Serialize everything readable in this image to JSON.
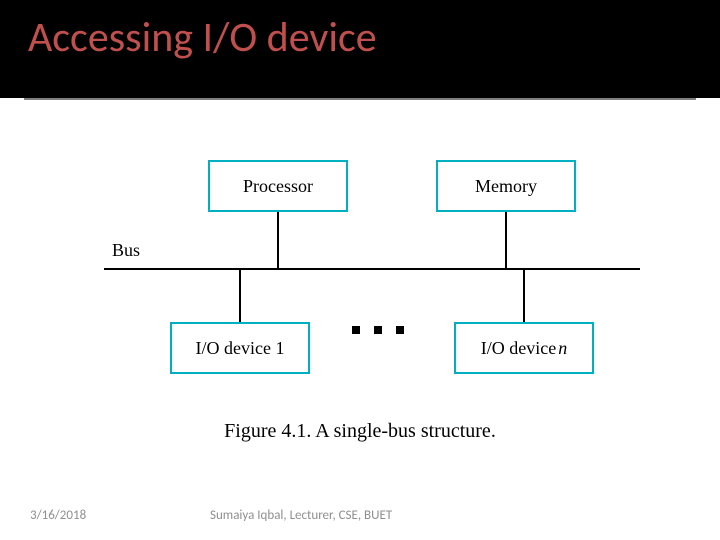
{
  "title": "Accessing I/O device",
  "bus_label": "Bus",
  "boxes": {
    "processor": "Processor",
    "memory": "Memory",
    "io1": "I/O device 1",
    "ion_prefix": "I/O device",
    "ion_n": "n"
  },
  "caption": "Figure 4.1.  A single-bus structure.",
  "footer": {
    "date": "3/16/2018",
    "author": "Sumaiya Iqbal, Lecturer, CSE, BUET"
  }
}
